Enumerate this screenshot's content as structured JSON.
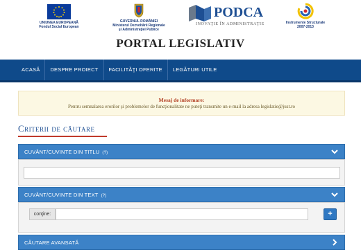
{
  "header": {
    "logos": {
      "eu_caption_1": "UNIUNEA EUROPEANĂ",
      "eu_caption_2": "Fondul Social European",
      "gov_caption_1": "GUVERNUL ROMÂNIEI",
      "gov_caption_2": "Ministerul Dezvoltării Regionale",
      "gov_caption_3": "şi Administraţiei Publice",
      "podca_word": "PODCA",
      "podca_tagline": "INOVAŢIE ÎN ADMINISTRAŢIE",
      "instr_caption_1": "Instrumente Structurale",
      "instr_caption_2": "2007-2013"
    },
    "title": "PORTAL LEGISLATIV"
  },
  "nav": {
    "items": [
      "ACASĂ",
      "DESPRE PROIECT",
      "FACILITĂŢI OFERITE",
      "LEGĂTURI UTILE"
    ]
  },
  "info": {
    "heading": "Mesaj de informare:",
    "text": "Pentru semnalarea erorilor şi problemelor de funcţionalitate ne puteţi transmite un e-mail la adresa legislatie@just.ro"
  },
  "search": {
    "section_title": "Criterii de căutare",
    "panels": [
      {
        "label": "CUVÂNT/CUVINTE DIN TITLU",
        "help": "(?)"
      },
      {
        "label": "CUVÂNT/CUVINTE DIN TEXT",
        "help": "(?)",
        "addon": "conţine:",
        "add_button": "+"
      },
      {
        "label": "CĂUTARE AVANSATĂ"
      }
    ]
  },
  "colors": {
    "nav_bg": "#0f4a8a",
    "panel_header": "#3c82c7",
    "title_accent": "#1e4f93",
    "underline_red": "#c0392b",
    "info_bg": "#fcf8e3"
  }
}
